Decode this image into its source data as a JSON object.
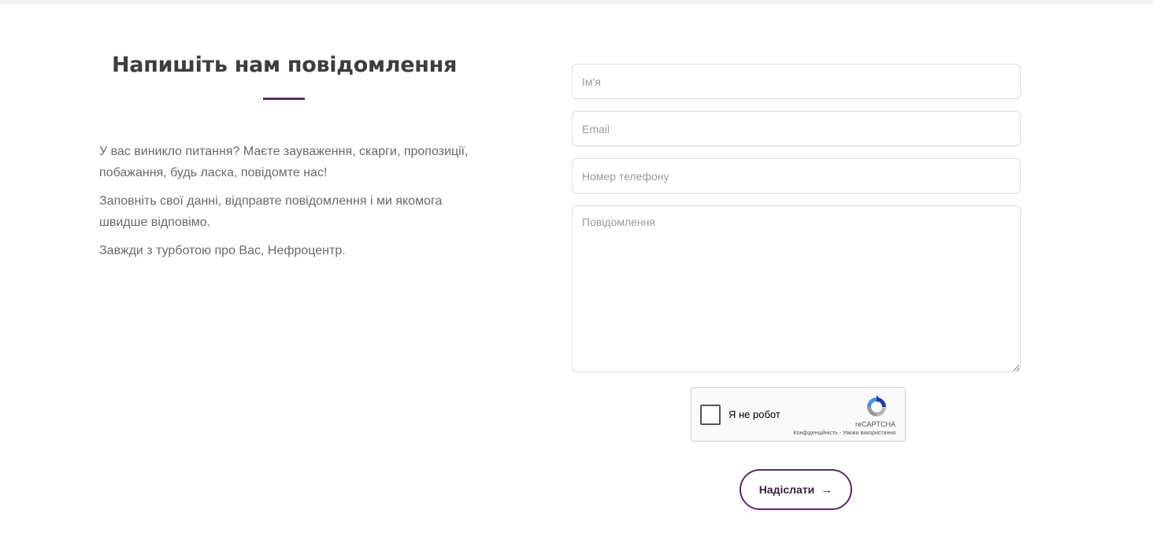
{
  "section": {
    "title": "Напишіть нам повідомлення",
    "paragraphs": [
      "У вас виникло питання? Маєте зауваження, скарги, пропозиції, побажання, будь ласка, повідомте нас!",
      "Заповніть свої данні, відправте повідомлення і ми якомога швидше відповімо.",
      "Завжди з турботою про Вас, Нефроцентр."
    ]
  },
  "form": {
    "name_placeholder": "Ім'я",
    "email_placeholder": "Email",
    "phone_placeholder": "Номер телефону",
    "message_placeholder": "Повідомлення",
    "recaptcha": {
      "label": "Я не робот",
      "brand": "reCAPTCHA",
      "privacy": "Конфіденційність",
      "separator": " - ",
      "terms": "Умови використання"
    },
    "submit_label": "Надіслати",
    "submit_icon": "→"
  },
  "colors": {
    "accent": "#5b2a63",
    "title": "#3d3d3d",
    "text": "#6a6a6a",
    "border": "#dcdcdc"
  }
}
